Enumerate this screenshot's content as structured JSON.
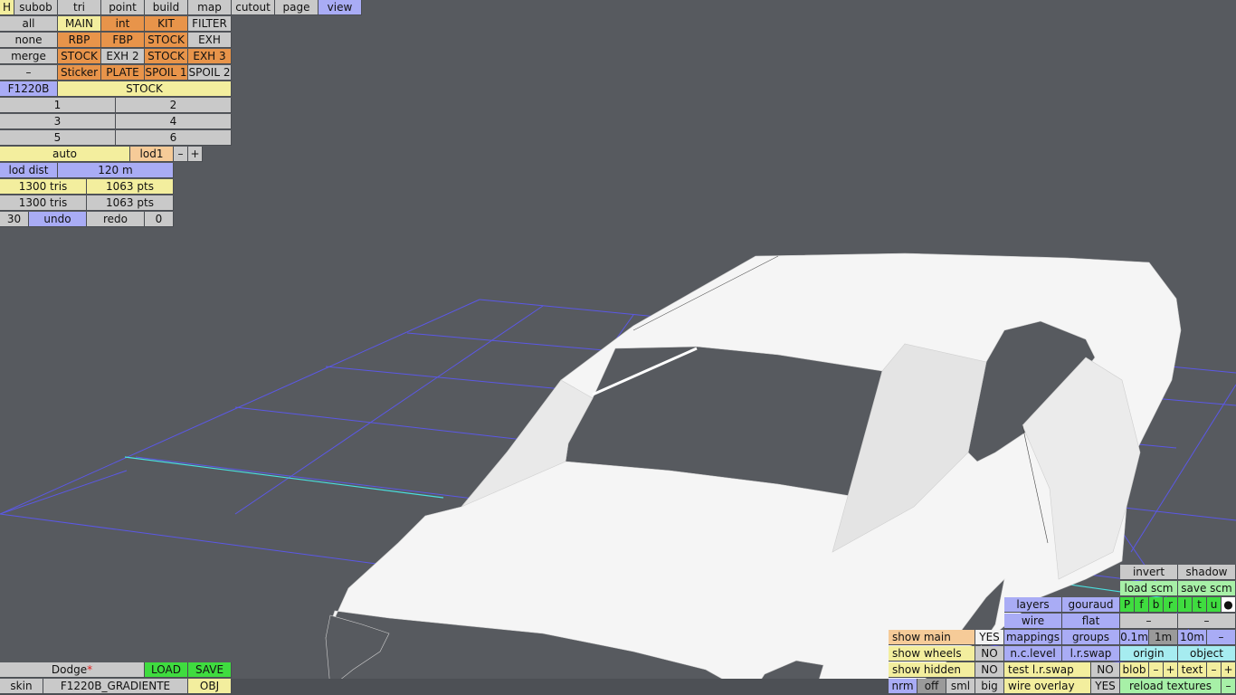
{
  "tabs": {
    "h": "H",
    "subob": "subob",
    "tri": "tri",
    "point": "point",
    "build": "build",
    "map": "map",
    "cutout": "cutout",
    "page": "page",
    "view": "view"
  },
  "parts": {
    "all": "all",
    "none": "none",
    "merge": "merge",
    "dash": "–",
    "main": "MAIN",
    "int": "int",
    "kit": "KIT",
    "filter": "FILTER",
    "rbp": "RBP",
    "fbp": "FBP",
    "stock1": "STOCK",
    "exh": "EXH",
    "stock2": "STOCK",
    "exh2": "EXH 2",
    "stock3": "STOCK",
    "exh3": "EXH 3",
    "sticker": "Sticker",
    "plate": "PLATE",
    "spoil1": "SPOIL 1",
    "spoil2": "SPOIL 2"
  },
  "model": {
    "name": "F1220B",
    "variant": "STOCK"
  },
  "slots": [
    "1",
    "2",
    "3",
    "4",
    "5",
    "6"
  ],
  "lod": {
    "mode": "auto",
    "level": "lod1",
    "minus": "–",
    "plus": "+",
    "dist_label": "lod dist",
    "dist_value": "120 m"
  },
  "stats": {
    "tris1": "1300 tris",
    "pts1": "1063 pts",
    "tris2": "1300 tris",
    "pts2": "1063 pts"
  },
  "history": {
    "count": "30",
    "undo": "undo",
    "redo": "redo",
    "pos": "0"
  },
  "file": {
    "name": "Dodge",
    "modified_mark": "*",
    "load": "LOAD",
    "save": "SAVE",
    "skin_label": "skin",
    "skin_value": "F1220B_GRADIENTE",
    "obj": "OBJ"
  },
  "view_panel": {
    "show_main": "show main",
    "show_main_val": "YES",
    "show_wheels": "show wheels",
    "show_wheels_val": "NO",
    "show_hidden": "show hidden",
    "show_hidden_val": "NO",
    "nrm": "nrm",
    "off": "off",
    "sml": "sml",
    "big": "big",
    "layers": "layers",
    "gouraud": "gouraud",
    "wire": "wire",
    "flat": "flat",
    "mappings": "mappings",
    "groups": "groups",
    "nclevel": "n.c.level",
    "lrswap": "l.r.swap",
    "test_lrswap": "test l.r.swap",
    "test_lrswap_val": "NO",
    "wire_overlay": "wire overlay",
    "wire_overlay_val": "YES",
    "invert": "invert",
    "shadow": "shadow",
    "load_scm": "load scm",
    "save_scm": "save scm",
    "flags": [
      "P",
      "f",
      "b",
      "r",
      "l",
      "t",
      "u",
      "●"
    ],
    "dash1": "–",
    "dash2": "–",
    "s01": "0.1m",
    "s1": "1m",
    "s10": "10m",
    "sdash": "–",
    "origin": "origin",
    "object": "object",
    "blob": "blob",
    "blob_minus": "–",
    "blob_plus": "+",
    "text": "text",
    "text_minus": "–",
    "text_plus": "+",
    "reload": "reload textures",
    "reload_dash": "–"
  }
}
